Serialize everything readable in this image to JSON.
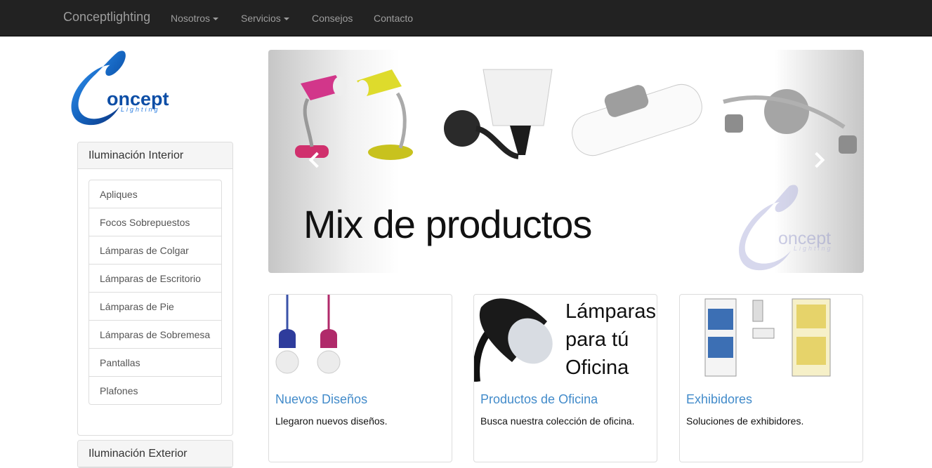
{
  "navbar": {
    "brand": "Conceptlighting",
    "items": [
      {
        "label": "Nosotros",
        "dropdown": true
      },
      {
        "label": "Servicios",
        "dropdown": true
      },
      {
        "label": "Consejos",
        "dropdown": false
      },
      {
        "label": "Contacto",
        "dropdown": false
      }
    ]
  },
  "logo": {
    "word": "oncept",
    "sub": "Lighting"
  },
  "sidebar": {
    "interior": {
      "title": "Iluminación Interior",
      "items": [
        {
          "label": "Apliques"
        },
        {
          "label": "Focos Sobrepuestos"
        },
        {
          "label": "Lámparas de Colgar"
        },
        {
          "label": "Lámparas de Escritorio"
        },
        {
          "label": "Lámparas de Pie"
        },
        {
          "label": "Lámparas de Sobremesa"
        },
        {
          "label": "Pantallas"
        },
        {
          "label": "Plafones"
        }
      ]
    },
    "exterior": {
      "title": "Iluminación Exterior"
    }
  },
  "carousel": {
    "caption": "Mix de productos",
    "watermark_word": "oncept",
    "watermark_sub": "Lighting"
  },
  "cards": [
    {
      "title": "Nuevos Diseños",
      "text": "Llegaron nuevos diseños."
    },
    {
      "title": "Productos de Oficina",
      "text": "Busca nuestra colección de oficina.",
      "image_text": [
        "Lámparas",
        "para tú",
        "Oficina"
      ]
    },
    {
      "title": "Exhibidores",
      "text": "Soluciones de exhibidores."
    }
  ],
  "colors": {
    "navbar_bg": "#222222",
    "link": "#428bca",
    "brand_blue": "#1a5fb4"
  }
}
